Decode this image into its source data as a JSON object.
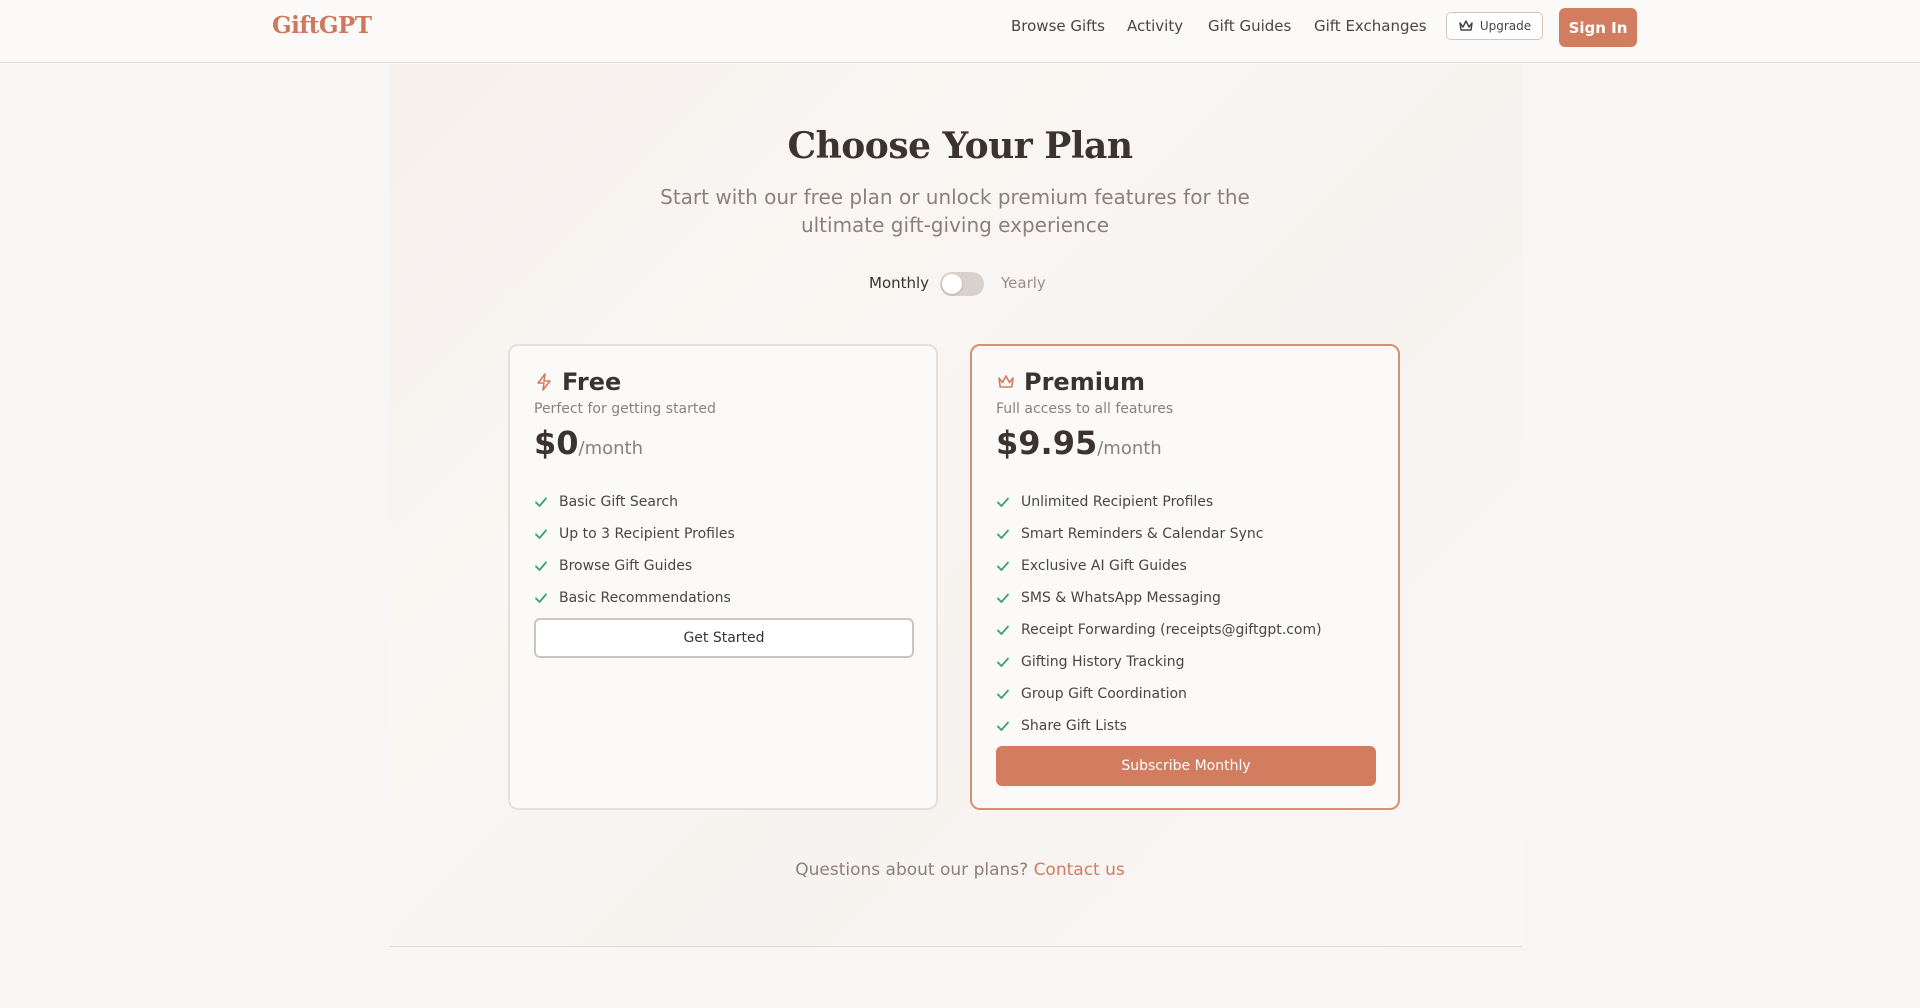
{
  "app": {
    "logo": "GiftGPT"
  },
  "nav": {
    "items": [
      "Browse Gifts",
      "Activity",
      "Gift Guides",
      "Gift Exchanges"
    ],
    "upgrade_label": "Upgrade",
    "signin_label": "Sign In"
  },
  "hero": {
    "title": "Choose Your Plan",
    "subtitle": "Start with our free plan or unlock premium features for the ultimate gift-giving experience"
  },
  "billing": {
    "monthly_label": "Monthly",
    "yearly_label": "Yearly",
    "yearly_selected": false
  },
  "plans": {
    "free": {
      "icon": "lightning-icon",
      "name": "Free",
      "description": "Perfect for getting started",
      "price": "$0",
      "period": "/month",
      "features": [
        "Basic Gift Search",
        "Up to 3 Recipient Profiles",
        "Browse Gift Guides",
        "Basic Recommendations"
      ],
      "cta": "Get Started"
    },
    "premium": {
      "icon": "crown-icon",
      "name": "Premium",
      "description": "Full access to all features",
      "price": "$9.95",
      "period": "/month",
      "features": [
        "Unlimited Recipient Profiles",
        "Smart Reminders & Calendar Sync",
        "Exclusive AI Gift Guides",
        "SMS & WhatsApp Messaging",
        "Receipt Forwarding (receipts@giftgpt.com)",
        "Gifting History Tracking",
        "Group Gift Coordination",
        "Share Gift Lists"
      ],
      "cta": "Subscribe Monthly"
    }
  },
  "footer": {
    "question": "Questions about our plans?",
    "contact_label": "Contact us"
  },
  "colors": {
    "accent": "#d27c60",
    "check": "#3aa36a",
    "text": "#3a3330",
    "muted": "#8b807a"
  }
}
